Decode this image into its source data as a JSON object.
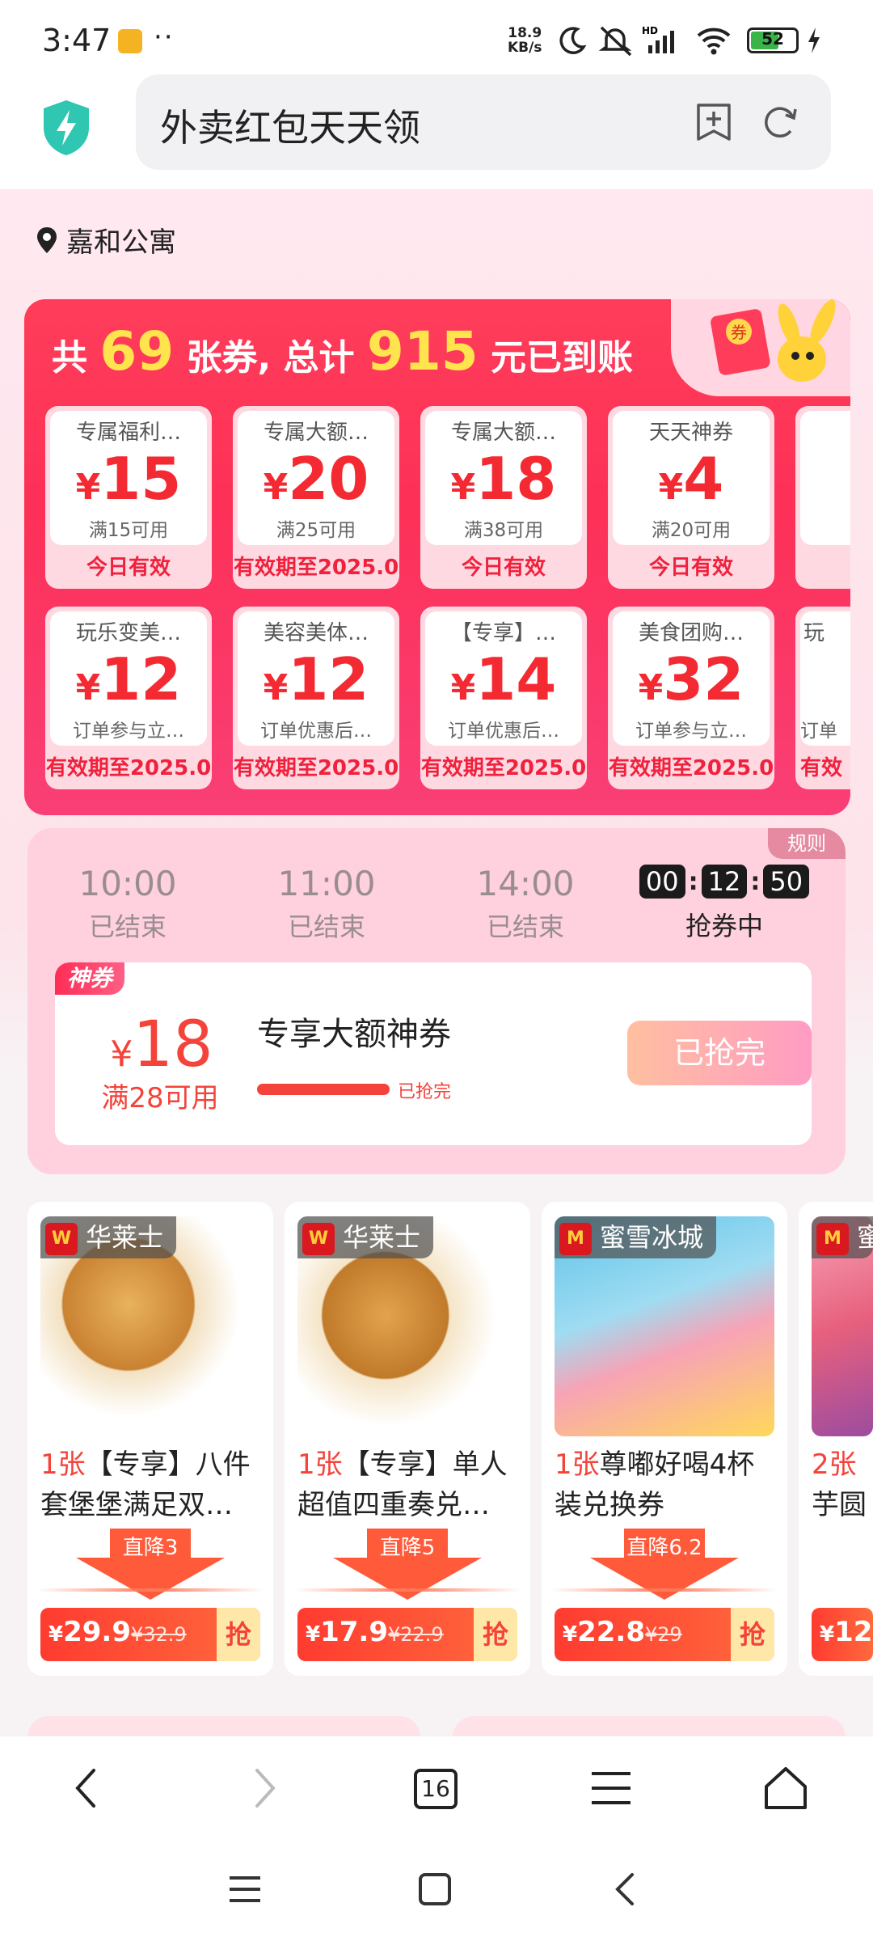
{
  "status_bar": {
    "time": "3:47",
    "net_speed_value": "18.9",
    "net_speed_unit": "KB/s",
    "battery": "52",
    "icons": [
      "app-notification-icon",
      "moon-icon",
      "mute-icon",
      "hd-signal-icon",
      "wifi-icon",
      "battery-icon",
      "charging-icon"
    ]
  },
  "address_bar": {
    "url_text": "外卖红包天天领",
    "icons": [
      "shield-lightning-icon",
      "add-bookmark-icon",
      "refresh-icon"
    ]
  },
  "location": {
    "label": "嘉和公寓"
  },
  "coupon_panel": {
    "headline_prefix": "共",
    "count": "69",
    "headline_mid": "张券, 总计",
    "total": "915",
    "headline_suffix": "元已到账",
    "row1": [
      {
        "name": "专属福利…",
        "amount": "15",
        "condition": "满15可用",
        "validity": "今日有效"
      },
      {
        "name": "专属大额…",
        "amount": "20",
        "condition": "满25可用",
        "validity": "有效期至2025.0"
      },
      {
        "name": "专属大额…",
        "amount": "18",
        "condition": "满38可用",
        "validity": "今日有效"
      },
      {
        "name": "天天神券",
        "amount": "4",
        "condition": "满20可用",
        "validity": "今日有效"
      }
    ],
    "row2": [
      {
        "name": "玩乐变美…",
        "amount": "12",
        "condition": "订单参与立…",
        "validity": "有效期至2025.0"
      },
      {
        "name": "美容美体…",
        "amount": "12",
        "condition": "订单优惠后…",
        "validity": "有效期至2025.0"
      },
      {
        "name": "【专享】…",
        "amount": "14",
        "condition": "订单优惠后…",
        "validity": "有效期至2025.0"
      },
      {
        "name": "美食团购…",
        "amount": "32",
        "condition": "订单参与立…",
        "validity": "有效期至2025.0"
      }
    ],
    "row2_partial_name": "玩",
    "row2_partial_cond": "订单",
    "row2_partial_valid": "有效",
    "currency": "¥"
  },
  "flash_sale": {
    "rule_label": "规则",
    "slots": [
      {
        "time": "10:00",
        "status": "已结束"
      },
      {
        "time": "11:00",
        "status": "已结束"
      },
      {
        "time": "14:00",
        "status": "已结束"
      }
    ],
    "countdown": {
      "h": "00",
      "m": "12",
      "s": "50"
    },
    "active_status": "抢券中",
    "deal": {
      "tag": "神券",
      "currency": "¥",
      "price": "18",
      "min_spend": "满28可用",
      "title": "专享大额神券",
      "progress_label": "已抢完",
      "progress": 1.0,
      "button": "已抢完"
    }
  },
  "products": [
    {
      "brand": "华莱士",
      "count": "1张",
      "title": "【专享】八件套堡堡满足双…",
      "drop": "直降3",
      "price": "29.9",
      "old_price": "¥32.9",
      "grab": "抢"
    },
    {
      "brand": "华莱士",
      "count": "1张",
      "title": "【专享】单人超值四重奏兑…",
      "drop": "直降5",
      "price": "17.9",
      "old_price": "¥22.9",
      "grab": "抢"
    },
    {
      "brand": "蜜雪冰城",
      "count": "1张",
      "title": "尊嘟好喝4杯装兑换券",
      "drop": "直降6.2",
      "price": "22.8",
      "old_price": "¥29",
      "grab": "抢"
    },
    {
      "brand": "蜜",
      "count": "2张",
      "title": "芋圆",
      "price": "12"
    }
  ],
  "colors": {
    "accent_red": "#f4433a",
    "panel_red": "#fd3057",
    "pink_bg": "#ffd0de"
  },
  "browser_nav": {
    "tabs_count": "16",
    "icons": [
      "back-icon",
      "forward-icon",
      "tabs-icon",
      "menu-icon",
      "home-icon"
    ]
  },
  "system_nav": {
    "icons": [
      "recent-apps-icon",
      "home-square-icon",
      "system-back-icon"
    ]
  }
}
